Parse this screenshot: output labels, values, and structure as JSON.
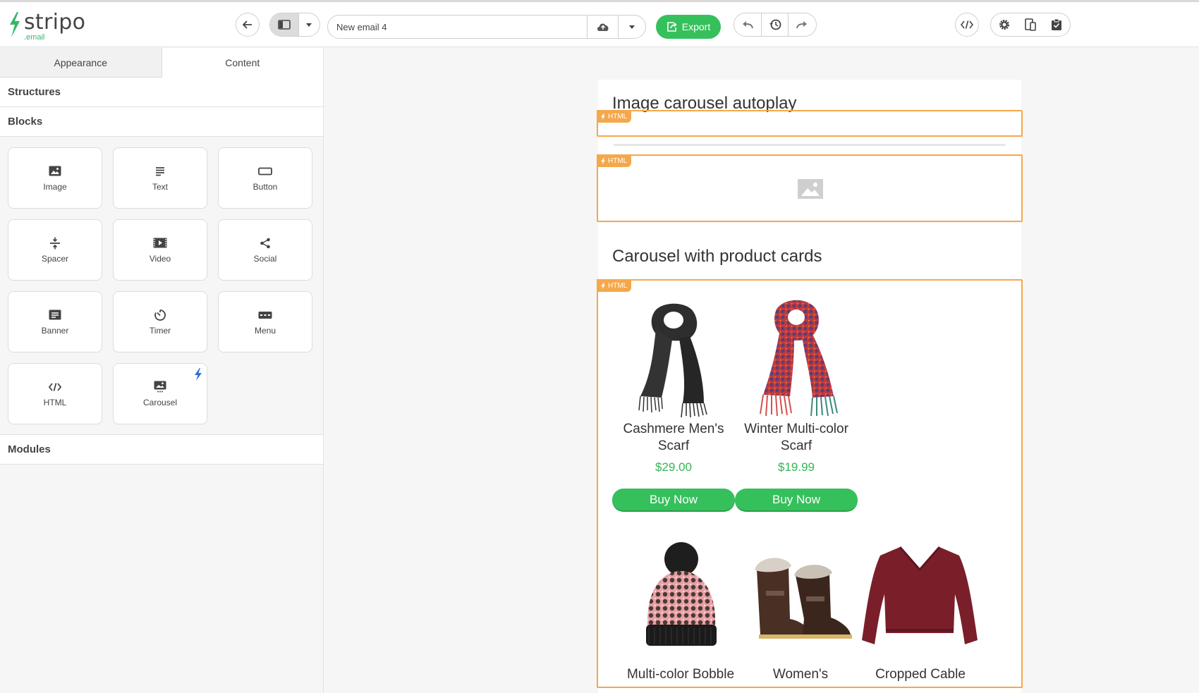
{
  "logo": {
    "name": "stripo",
    "sub": ".email"
  },
  "toolbar": {
    "email_name": "New email 4",
    "export_label": "Export"
  },
  "sidebar": {
    "tabs": [
      {
        "label": "Appearance"
      },
      {
        "label": "Content"
      }
    ],
    "structures_label": "Structures",
    "blocks_label": "Blocks",
    "modules_label": "Modules",
    "blocks": [
      {
        "label": "Image",
        "icon": "image-icon"
      },
      {
        "label": "Text",
        "icon": "text-icon"
      },
      {
        "label": "Button",
        "icon": "button-icon"
      },
      {
        "label": "Spacer",
        "icon": "spacer-icon"
      },
      {
        "label": "Video",
        "icon": "video-icon"
      },
      {
        "label": "Social",
        "icon": "share-icon"
      },
      {
        "label": "Banner",
        "icon": "banner-icon"
      },
      {
        "label": "Timer",
        "icon": "timer-icon"
      },
      {
        "label": "Menu",
        "icon": "menu-icon"
      },
      {
        "label": "HTML",
        "icon": "code-icon"
      },
      {
        "label": "Carousel",
        "icon": "carousel-icon"
      }
    ]
  },
  "email": {
    "title1": "Image carousel autoplay",
    "title2": "Carousel with product cards",
    "html_tag": "HTML",
    "products": [
      {
        "name": "Cashmere Men's Scarf",
        "price": "$29.00",
        "button": "Buy Now"
      },
      {
        "name": "Winter Multi-color Scarf",
        "price": "$19.99",
        "button": "Buy Now"
      }
    ],
    "products_row2": [
      {
        "name": "Multi-color Bobble"
      },
      {
        "name": "Women's"
      },
      {
        "name": "Cropped Cable"
      }
    ]
  },
  "colors": {
    "accent": "#35c05c",
    "html_border": "#f5a84a",
    "price": "#35b653"
  }
}
